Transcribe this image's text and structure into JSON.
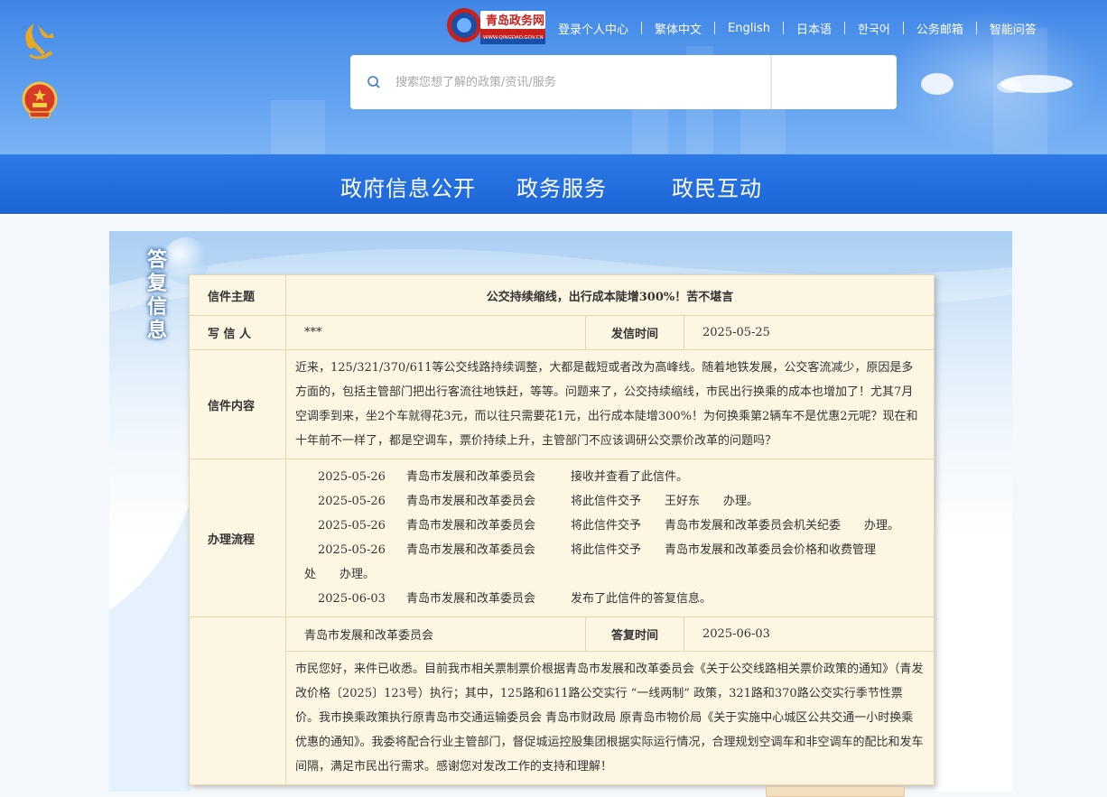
{
  "header": {
    "logo_text": "青岛政务网",
    "logo_sub": "WWW.QINGDAO.GOV.CN",
    "top_links": [
      "登录个人中心",
      "繁体中文",
      "English",
      "日本语",
      "한국어",
      "公务邮箱",
      "智能问答"
    ],
    "search_placeholder": "搜索您想了解的政策/资讯/服务"
  },
  "main_nav": [
    "政府信息公开",
    "政务服务",
    "政民互动"
  ],
  "panel": {
    "title": "答复信息"
  },
  "letter": {
    "subject_label": "信件主题",
    "subject": "公交持续缩线，出行成本陡增300%！苦不堪言",
    "writer_label": "写 信 人",
    "writer": "***",
    "sent_time_label": "发信时间",
    "sent_time": "2025-05-25",
    "content_label": "信件内容",
    "content": "近来，125/321/370/611等公交线路持续调整，大都是截短或者改为高峰线。随着地铁发展，公交客流减少，原因是多方面的，包括主管部门把出行客流往地铁赶，等等。问题来了，公交持续缩线，市民出行换乘的成本也增加了！尤其7月空调季到来，坐2个车就得花3元，而以往只需要花1元，出行成本陡增300%！为何换乘第2辆车不是优惠2元呢？现在和十年前不一样了，都是空调车，票价持续上升，主管部门不应该调研公交票价改革的问题吗？",
    "process_label": "办理流程",
    "process": [
      {
        "date": "2025-05-26",
        "org": "青岛市发展和改革委员会",
        "action": "接收并查看了此信件。"
      },
      {
        "date": "2025-05-26",
        "org": "青岛市发展和改革委员会",
        "action": "将此信件交予　　王好东　　办理。"
      },
      {
        "date": "2025-05-26",
        "org": "青岛市发展和改革委员会",
        "action": "将此信件交予　　青岛市发展和改革委员会机关纪委　　办理。"
      },
      {
        "date": "2025-05-26",
        "org": "青岛市发展和改革委员会",
        "action": "将此信件交予　　青岛市发展和改革委员会价格和收费管理"
      },
      {
        "date": "",
        "org": "",
        "action": "处　　办理。"
      },
      {
        "date": "2025-06-03",
        "org": "青岛市发展和改革委员会",
        "action": "发布了此信件的答复信息。"
      }
    ],
    "reply_org": "青岛市发展和改革委员会",
    "reply_time_label": "答复时间",
    "reply_time": "2025-06-03",
    "reply": "市民您好，来件已收悉。目前我市相关票制票价根据青岛市发展和改革委员会《关于公交线路相关票价政策的通知》（青发改价格〔2025〕123号）执行；其中，125路和611路公交实行 “一线两制” 政策，321路和370路公交实行季节性票价。我市换乘政策执行原青岛市交通运输委员会 青岛市财政局 原青岛市物价局《关于实施中心城区公共交通一小时换乘优惠的通知》。我委将配合行业主管部门，督促城运控股集团根据实际运行情况，合理规划空调车和非空调车的配比和发车间隔，满足市民出行需求。感谢您对发改工作的支持和理解！"
  }
}
